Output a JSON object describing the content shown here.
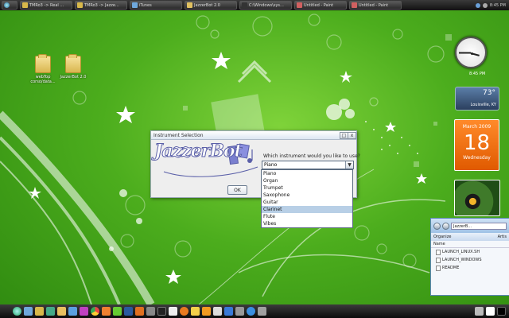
{
  "taskbar": {
    "items": [
      {
        "label": "TMRo3 -> Real ...",
        "color": "#d8b84a"
      },
      {
        "label": "TMRo3 -> Jazze...",
        "color": "#d8b84a"
      },
      {
        "label": "iTunes",
        "color": "#6fa8dc"
      },
      {
        "label": "JazzerBot 2.0",
        "color": "#e0c060"
      },
      {
        "label": "C:\\Windows\\sys...",
        "color": "#333333"
      },
      {
        "label": "Untitled - Paint",
        "color": "#d06060"
      },
      {
        "label": "Untitled - Paint",
        "color": "#d06060"
      }
    ],
    "clock": "8:45 PM"
  },
  "desktop": {
    "icons": [
      {
        "label": "webTop corso/data...",
        "icon": "folder-icon"
      },
      {
        "label": "JazzerBot 2.0",
        "icon": "folder-icon"
      }
    ]
  },
  "gadgets": {
    "clock_label": "8:45 PM",
    "weather": {
      "temp": "73°",
      "location": "Louisville, KY"
    },
    "calendar": {
      "month_year": "March 2009",
      "day": "18",
      "weekday": "Wednesday"
    }
  },
  "explorer": {
    "address": "JazzerB...",
    "organize": "Organize",
    "column": "Name",
    "column2": "Artis",
    "files": [
      "LAUNCH_LINUX.SH",
      "LAUNCH_WINDOWS",
      "README"
    ]
  },
  "dialog": {
    "title": "Instrument Selection",
    "logo_text": "JazzerBot",
    "question": "Which instrument would you like to use?",
    "selected": "Piano",
    "ok_label": "OK",
    "options": [
      "Piano",
      "Organ",
      "Trumpet",
      "Saxophone",
      "Guitar",
      "Clarinet",
      "Flute",
      "Vibes"
    ],
    "highlighted": "Clarinet",
    "close_label": "x",
    "max_label": "□"
  },
  "colors": {
    "wallpaper": "#4cad1d",
    "logo_purple": "#5a5fa8",
    "highlight": "#b8cfe6",
    "calendar_orange": "#e05a00"
  }
}
